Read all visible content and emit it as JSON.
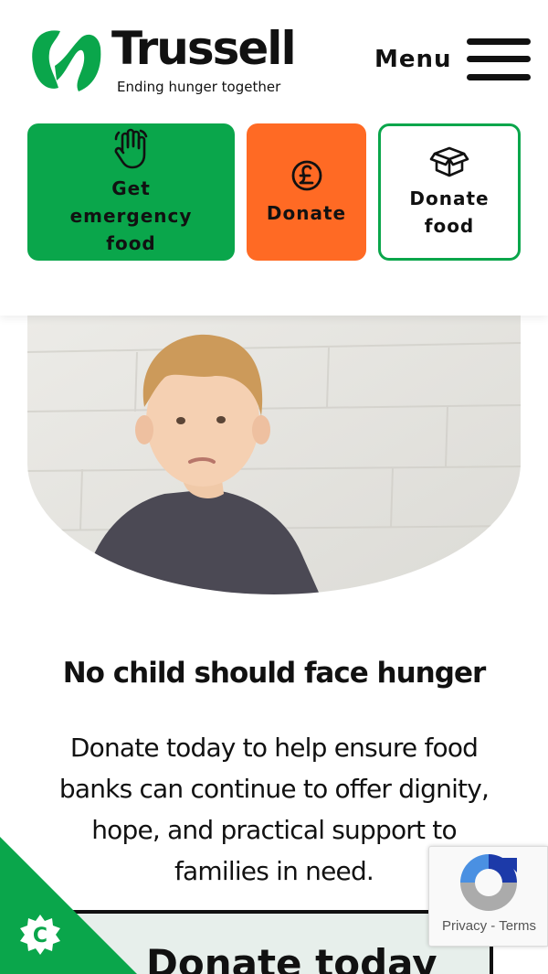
{
  "brand": {
    "name": "Trussell",
    "tagline": "Ending hunger together",
    "green": "#0aa64b",
    "orange": "#ff6a24"
  },
  "header": {
    "menu_label": "Menu"
  },
  "actions": [
    {
      "label": "Get emergency food",
      "icon": "hand-wave-icon"
    },
    {
      "label": "Donate",
      "icon": "pound-sign-icon"
    },
    {
      "label": "Donate food",
      "icon": "box-icon"
    }
  ],
  "hero": {
    "image": "child-photo"
  },
  "content": {
    "headline": "No child should face hunger",
    "body": "Donate today to help ensure food banks can continue to offer dignity, hope, and practical support to families in need.",
    "donate_box_title": "Donate today"
  },
  "cookie": {
    "icon": "cookie-settings-icon",
    "letter": "C"
  },
  "recaptcha": {
    "privacy": "Privacy",
    "separator": " - ",
    "terms": "Terms"
  }
}
